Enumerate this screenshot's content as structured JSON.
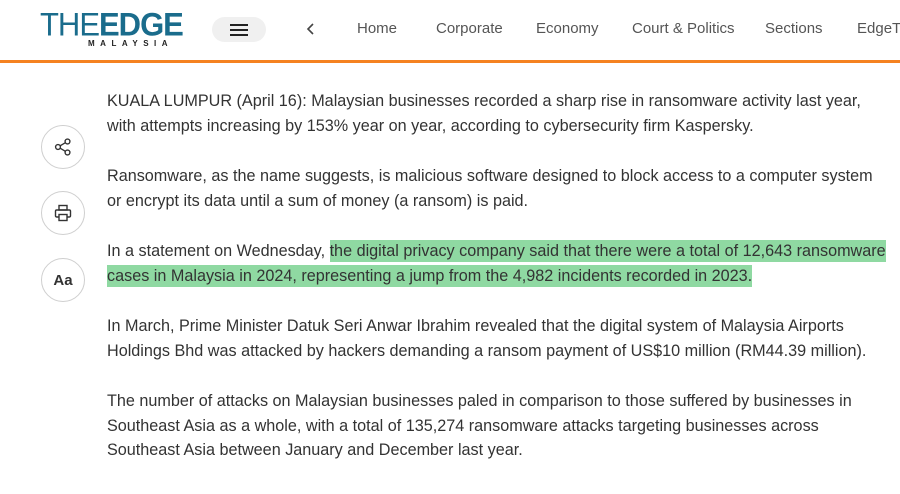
{
  "header": {
    "logo_main": "THEEDGE",
    "logo_sub": "MALAYSIA",
    "accent_color": "#f58220",
    "logo_color": "#1a6c8c",
    "menu_icon": "hamburger-icon",
    "back_icon": "chevron-left-icon",
    "nav": [
      "Home",
      "Corporate",
      "Economy",
      "Court & Politics",
      "Sections",
      "EdgeTV"
    ]
  },
  "tools": {
    "share_icon": "share-icon",
    "print_icon": "print-icon",
    "font_size_label": "Aa"
  },
  "article": {
    "p1": "KUALA LUMPUR (April 16): Malaysian businesses recorded a sharp rise in ransomware activity last year, with attempts increasing by 153% year on year, according to cybersecurity firm Kaspersky.",
    "p2": "Ransomware, as the name suggests, is malicious software designed to block access to a computer system or encrypt its data until a sum of money (a ransom) is paid.",
    "p3_plain": "In a statement on Wednesday, ",
    "p3_highlight": "the digital privacy company said that there were a total of 12,643 ransomware cases in Malaysia in 2024, representing a jump from the 4,982 incidents recorded in 2023.",
    "highlight_color": "#8fd9a2",
    "p4": "In March, Prime Minister Datuk Seri Anwar Ibrahim revealed that the digital system of Malaysia Airports Holdings Bhd was attacked by hackers demanding a ransom payment of US$10 million (RM44.39 million).",
    "p5": "The number of attacks on Malaysian businesses paled in comparison to those suffered by businesses in Southeast Asia as a whole, with a total of 135,274 ransomware attacks targeting businesses across Southeast Asia between January and December last year."
  }
}
